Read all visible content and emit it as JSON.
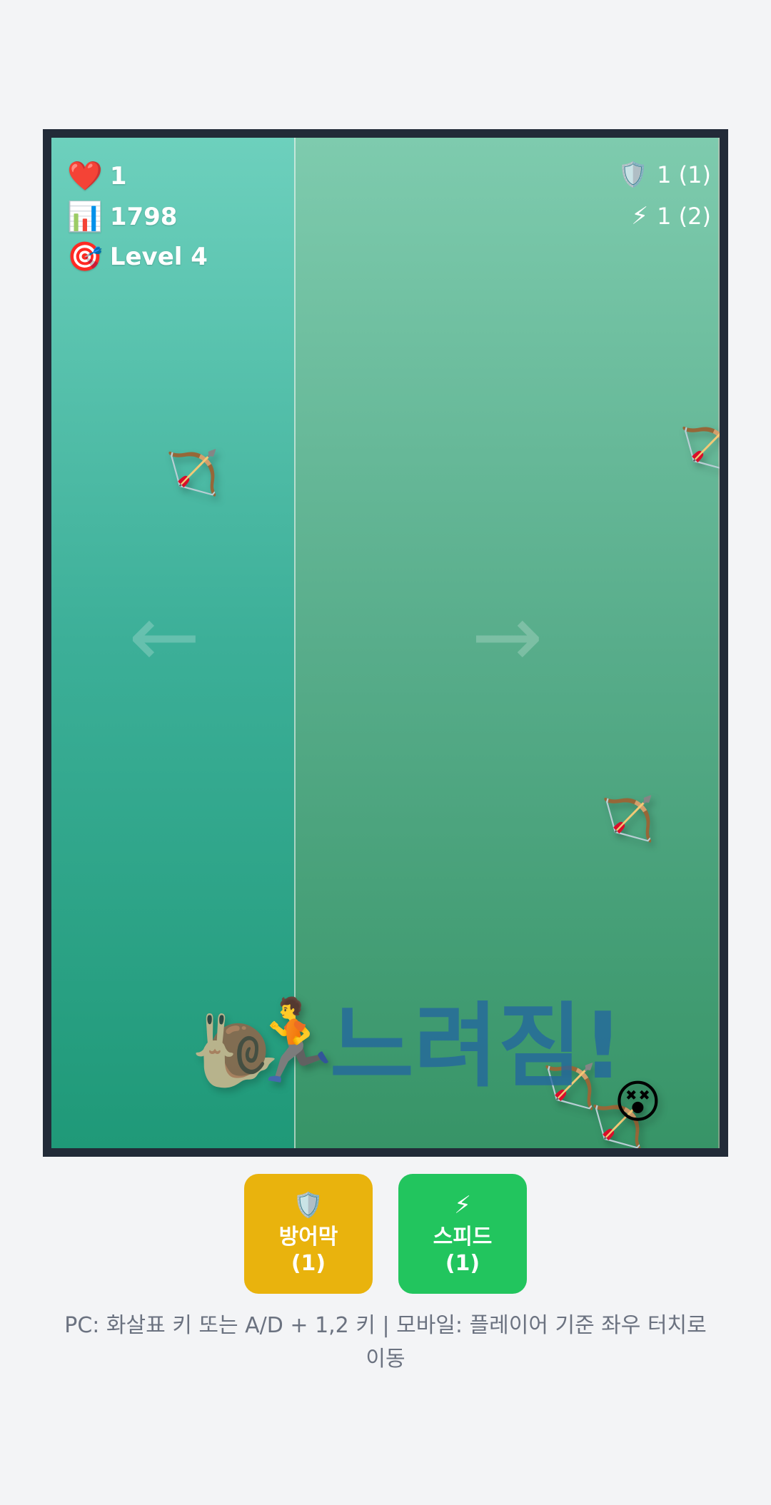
{
  "hud": {
    "lives_icon": "heart-icon",
    "lives": "1",
    "score_icon": "bar-chart-icon",
    "score": "1798",
    "level_icon": "target-icon",
    "level": "Level 4",
    "shield_icon": "shield-icon",
    "shield": "1 (1)",
    "speed_icon": "lightning-icon",
    "speed": "1 (2)"
  },
  "lane_hints": {
    "left": "←",
    "right": "→"
  },
  "status_text": "느려짐!",
  "sprites": {
    "arrow_icon": "bow-and-arrow-icon",
    "player_icon": "running-person-icon",
    "slow_icon": "snail-icon",
    "dizzy_icon": "dizzy-face-icon"
  },
  "buttons": {
    "shield_label": "방어막",
    "shield_count": "(1)",
    "shield_color": "#e9b30d",
    "speed_label": "스피드",
    "speed_count": "(1)",
    "speed_color": "#22c55e"
  },
  "controls_hint": "PC: 화살표 키 또는 A/D + 1,2 키 | 모바일: 플레이어 기준 좌우 터치로 이동"
}
